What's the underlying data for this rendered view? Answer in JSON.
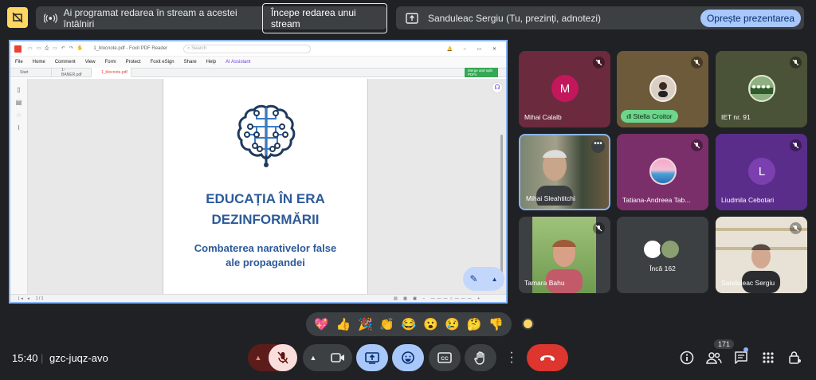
{
  "top_bar": {
    "streaming_text": "Ai programat redarea în stream a acestei întâlniri",
    "start_stream_label": "Începe redarea unui stream",
    "presenter_text": "Sanduleac Sergiu (Tu, prezinți, adnotezi)",
    "stop_presenting_label": "Oprește prezentarea"
  },
  "shared_screen": {
    "window_title": "1_blocnote.pdf - Foxit PDF Reader",
    "search_placeholder": "Search",
    "menu": [
      "File",
      "Home",
      "Comment",
      "View",
      "Form",
      "Protect",
      "Foxit eSign",
      "Share",
      "Help",
      "AI Assistant"
    ],
    "tabs": [
      "Start",
      "1-BANER.pdf",
      "1_blocnote.pdf"
    ],
    "promo": "Merge and split PDFs",
    "doc_title_line1": "EDUCAȚIA ÎN ERA",
    "doc_title_line2": "DEZINFORMĂRII",
    "doc_sub_line1": "Combaterea narativelor false",
    "doc_sub_line2": "ale propagandei",
    "page_indicator": "1 / 1"
  },
  "participants": [
    {
      "name": "Mihai Calalb",
      "initial": "M"
    },
    {
      "name": "Stella Croitor"
    },
    {
      "name": "IET nr. 91"
    },
    {
      "name": "Mihai Sleahtitchi"
    },
    {
      "name": "Tatiana-Andreea Tab..."
    },
    {
      "name": "Liudmila Cebotari",
      "initial": "L"
    },
    {
      "name": "Tamara Bahu"
    },
    {
      "name": "Încă 162"
    },
    {
      "name": "Sanduleac Sergiu"
    }
  ],
  "reactions": [
    "💖",
    "👍",
    "🎉",
    "👏",
    "😂",
    "😮",
    "😢",
    "🤔",
    "👎"
  ],
  "bottom_bar": {
    "time": "15:40",
    "meeting_code": "gzc-juqz-avo",
    "people_count": "171"
  },
  "colors": {
    "accent": "#a8c7fa",
    "end_call": "#ea4335",
    "warning": "#fdd663"
  }
}
